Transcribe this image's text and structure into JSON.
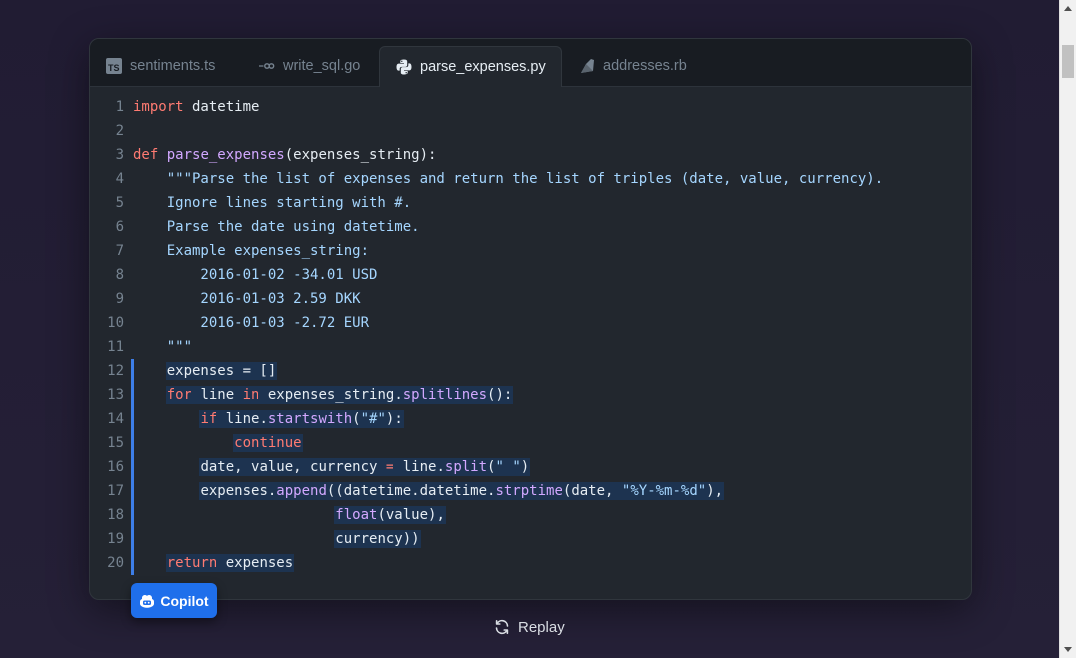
{
  "tabs": [
    {
      "label": "sentiments.ts",
      "icon": "typescript-icon",
      "active": false
    },
    {
      "label": "write_sql.go",
      "icon": "go-icon",
      "active": false
    },
    {
      "label": "parse_expenses.py",
      "icon": "python-icon",
      "active": true
    },
    {
      "label": "addresses.rb",
      "icon": "ruby-icon",
      "active": false
    }
  ],
  "code": {
    "language": "python",
    "lines": [
      {
        "n": "1",
        "tokens": [
          [
            "kw",
            "import"
          ],
          [
            "pl",
            " datetime"
          ]
        ]
      },
      {
        "n": "2",
        "tokens": []
      },
      {
        "n": "3",
        "tokens": [
          [
            "kw",
            "def"
          ],
          [
            "pl",
            " "
          ],
          [
            "fn",
            "parse_expenses"
          ],
          [
            "pl",
            "(expenses_string):"
          ]
        ]
      },
      {
        "n": "4",
        "tokens": [
          [
            "st",
            "    \"\"\"Parse the list of expenses and return the list of triples (date, value, currency)."
          ]
        ]
      },
      {
        "n": "5",
        "tokens": [
          [
            "st",
            "    Ignore lines starting with #."
          ]
        ]
      },
      {
        "n": "6",
        "tokens": [
          [
            "st",
            "    Parse the date using datetime."
          ]
        ]
      },
      {
        "n": "7",
        "tokens": [
          [
            "st",
            "    Example expenses_string:"
          ]
        ]
      },
      {
        "n": "8",
        "tokens": [
          [
            "st",
            "        2016-01-02 -34.01 USD"
          ]
        ]
      },
      {
        "n": "9",
        "tokens": [
          [
            "st",
            "        2016-01-03 2.59 DKK"
          ]
        ]
      },
      {
        "n": "10",
        "tokens": [
          [
            "st",
            "        2016-01-03 -2.72 EUR"
          ]
        ]
      },
      {
        "n": "11",
        "tokens": [
          [
            "st",
            "    \"\"\""
          ]
        ]
      },
      {
        "n": "12",
        "hl": true,
        "tokens": [
          [
            "pl",
            "    expenses = []"
          ]
        ]
      },
      {
        "n": "13",
        "hl": true,
        "tokens": [
          [
            "pl",
            "    "
          ],
          [
            "kw",
            "for"
          ],
          [
            "pl",
            " line "
          ],
          [
            "kw",
            "in"
          ],
          [
            "pl",
            " expenses_string."
          ],
          [
            "fn",
            "splitlines"
          ],
          [
            "pl",
            "():"
          ]
        ]
      },
      {
        "n": "14",
        "hl": true,
        "tokens": [
          [
            "pl",
            "        "
          ],
          [
            "kw",
            "if"
          ],
          [
            "pl",
            " line."
          ],
          [
            "fn",
            "startswith"
          ],
          [
            "pl",
            "("
          ],
          [
            "st",
            "\"#\""
          ],
          [
            "pl",
            "):"
          ]
        ]
      },
      {
        "n": "15",
        "hl": true,
        "tokens": [
          [
            "pl",
            "            "
          ],
          [
            "kw",
            "continue"
          ]
        ]
      },
      {
        "n": "16",
        "hl": true,
        "tokens": [
          [
            "pl",
            "        date, value, currency "
          ],
          [
            "kw",
            "="
          ],
          [
            "pl",
            " line."
          ],
          [
            "fn",
            "split"
          ],
          [
            "pl",
            "("
          ],
          [
            "st",
            "\" \""
          ],
          [
            "pl",
            ")"
          ]
        ]
      },
      {
        "n": "17",
        "hl": true,
        "tokens": [
          [
            "pl",
            "        expenses."
          ],
          [
            "fn",
            "append"
          ],
          [
            "pl",
            "((datetime.datetime."
          ],
          [
            "fn",
            "strptime"
          ],
          [
            "pl",
            "(date, "
          ],
          [
            "st",
            "\"%Y-%m-%d\""
          ],
          [
            "pl",
            "),"
          ]
        ]
      },
      {
        "n": "18",
        "hl": true,
        "tokens": [
          [
            "pl",
            "                        "
          ],
          [
            "fn",
            "float"
          ],
          [
            "pl",
            "(value),"
          ]
        ]
      },
      {
        "n": "19",
        "hl": true,
        "tokens": [
          [
            "pl",
            "                        currency))"
          ]
        ]
      },
      {
        "n": "20",
        "hl": true,
        "tokens": [
          [
            "pl",
            "    "
          ],
          [
            "kw",
            "return"
          ],
          [
            "pl",
            " expenses"
          ]
        ]
      }
    ]
  },
  "copilot_label": "Copilot",
  "replay_label": "Replay",
  "colors": {
    "accent": "#1f6feb",
    "keyword": "#ff7b72",
    "function": "#d2a8ff",
    "string": "#a5d6ff",
    "highlight": "#1d3350"
  }
}
